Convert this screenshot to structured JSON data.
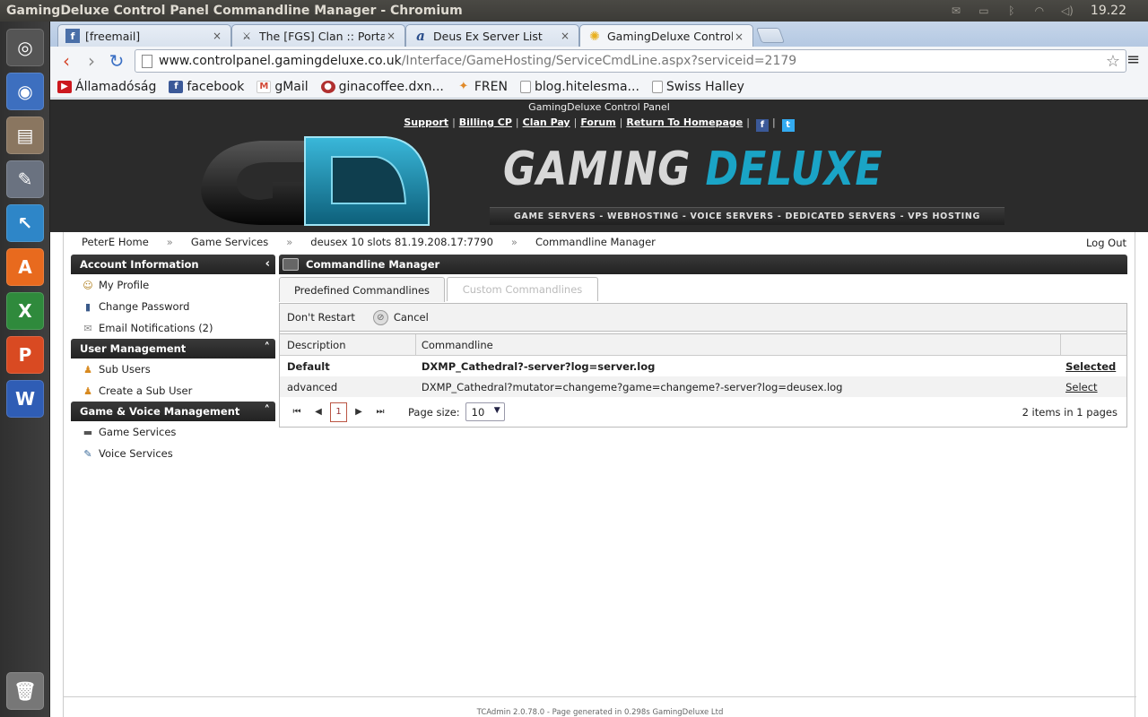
{
  "window": {
    "title": "GamingDeluxe Control Panel Commandline Manager - Chromium",
    "clock": "19.22"
  },
  "tray_icons": [
    "mail-icon",
    "battery-icon",
    "bluetooth-icon",
    "wifi-icon",
    "volume-icon"
  ],
  "tabs": [
    {
      "label": "[freemail]",
      "icon": "freemail-icon",
      "close": "×"
    },
    {
      "label": "The [FGS] Clan :: Portal",
      "icon": "fgs-icon",
      "close": "×"
    },
    {
      "label": "Deus Ex Server List",
      "icon": "deusex-icon",
      "close": "×"
    },
    {
      "label": "GamingDeluxe Control Pa",
      "icon": "gamingdeluxe-icon",
      "close": "×"
    }
  ],
  "address": {
    "host": "www.controlpanel.gamingdeluxe.co.uk",
    "path": "/Interface/GameHosting/ServiceCmdLine.aspx?serviceid=2179"
  },
  "bookmarks": [
    {
      "label": "Államadóság",
      "icon": "youtube-icon",
      "color": "#cc181e"
    },
    {
      "label": "facebook",
      "icon": "facebook-icon",
      "color": "#3b5998"
    },
    {
      "label": "gMail",
      "icon": "gmail-icon",
      "color": "#d14836"
    },
    {
      "label": "ginacoffee.dxn...",
      "icon": "ginacoffee-icon",
      "color": "#b03030"
    },
    {
      "label": "FREN",
      "icon": "fren-icon",
      "color": "#e08a2a"
    },
    {
      "label": "blog.hitelesma...",
      "icon": "page-icon",
      "color": "#bbbbbb"
    },
    {
      "label": "Swiss Halley",
      "icon": "page-icon",
      "color": "#bbbbbb"
    }
  ],
  "site": {
    "panel_title": "GamingDeluxe Control Panel",
    "links": [
      "Support",
      "Billing CP",
      "Clan Pay",
      "Forum",
      "Return To Homepage"
    ],
    "brand_1": "GAMING",
    "brand_2": "DELUXE",
    "tagline": "GAME SERVERS - WEBHOSTING - VOICE SERVERS - DEDICATED SERVERS - VPS HOSTING"
  },
  "breadcrumbs": [
    "PeterE Home",
    "Game Services",
    "deusex 10 slots 81.19.208.17:7790",
    "Commandline Manager"
  ],
  "breadcrumb_sep": "»",
  "logout": "Log Out",
  "sidebar": {
    "account": {
      "title": "Account Information",
      "items": [
        "My Profile",
        "Change Password",
        "Email Notifications (2)"
      ]
    },
    "user_mgmt": {
      "title": "User Management",
      "items": [
        "Sub Users",
        "Create a Sub User"
      ]
    },
    "game_voice": {
      "title": "Game & Voice Management",
      "items": [
        "Game Services",
        "Voice Services"
      ]
    }
  },
  "main": {
    "title": "Commandline Manager",
    "tab_active": "Predefined Commandlines",
    "tab_inactive": "Custom Commandlines",
    "dont_restart": "Don't Restart",
    "cancel": "Cancel",
    "columns": [
      "Description",
      "Commandline"
    ],
    "rows": [
      {
        "description": "Default",
        "commandline": "DXMP_Cathedral?-server?log=server.log",
        "action": "Selected"
      },
      {
        "description": "advanced",
        "commandline": "DXMP_Cathedral?mutator=changeme?game=changeme?-server?log=deusex.log",
        "action": "Select"
      }
    ],
    "pager": {
      "page": "1",
      "page_size_label": "Page size:",
      "page_size": "10",
      "info": "2 items in 1 pages"
    }
  },
  "footer": "TCAdmin 2.0.78.0 - Page generated in 0.298s GamingDeluxe Ltd"
}
